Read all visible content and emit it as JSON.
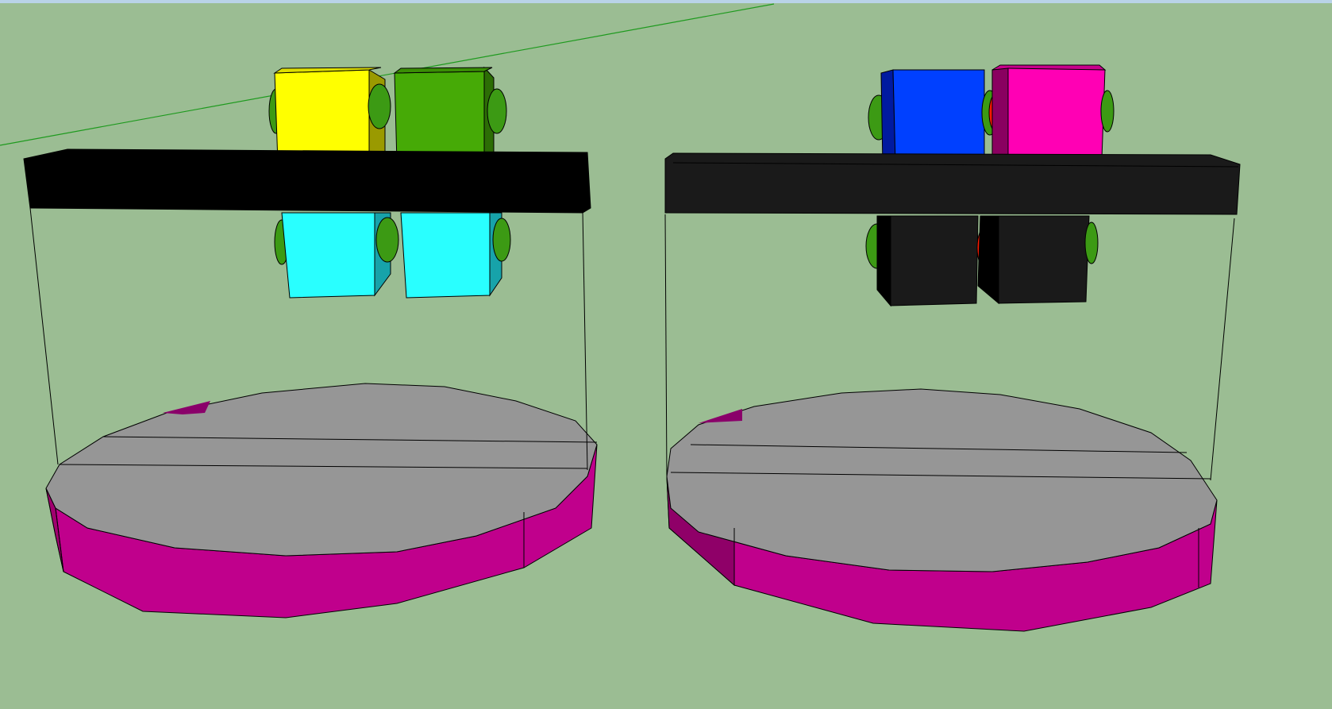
{
  "scene": {
    "background_color": "#9bbd93",
    "axis_line_color": "#1e9a1e",
    "models": [
      {
        "name": "left-assembly",
        "crossbar_color": "#000000",
        "top_blocks": [
          "#ffff00",
          "#46aa06"
        ],
        "bottom_blocks": [
          "#29ffff",
          "#29ffff"
        ],
        "connector_color": "#3c9a14",
        "platform_top_color": "#969696",
        "platform_side_color": "#c0008c"
      },
      {
        "name": "right-assembly",
        "crossbar_color": "#1a1a1a",
        "top_blocks": [
          "#0040ff",
          "#ff00b4"
        ],
        "bottom_blocks": [
          "#1a1a1a",
          "#1a1a1a"
        ],
        "connector_color": "#3c9a14",
        "accent_connector_color": "#ff1a00",
        "platform_top_color": "#969696",
        "platform_side_color": "#c0008c"
      }
    ]
  }
}
